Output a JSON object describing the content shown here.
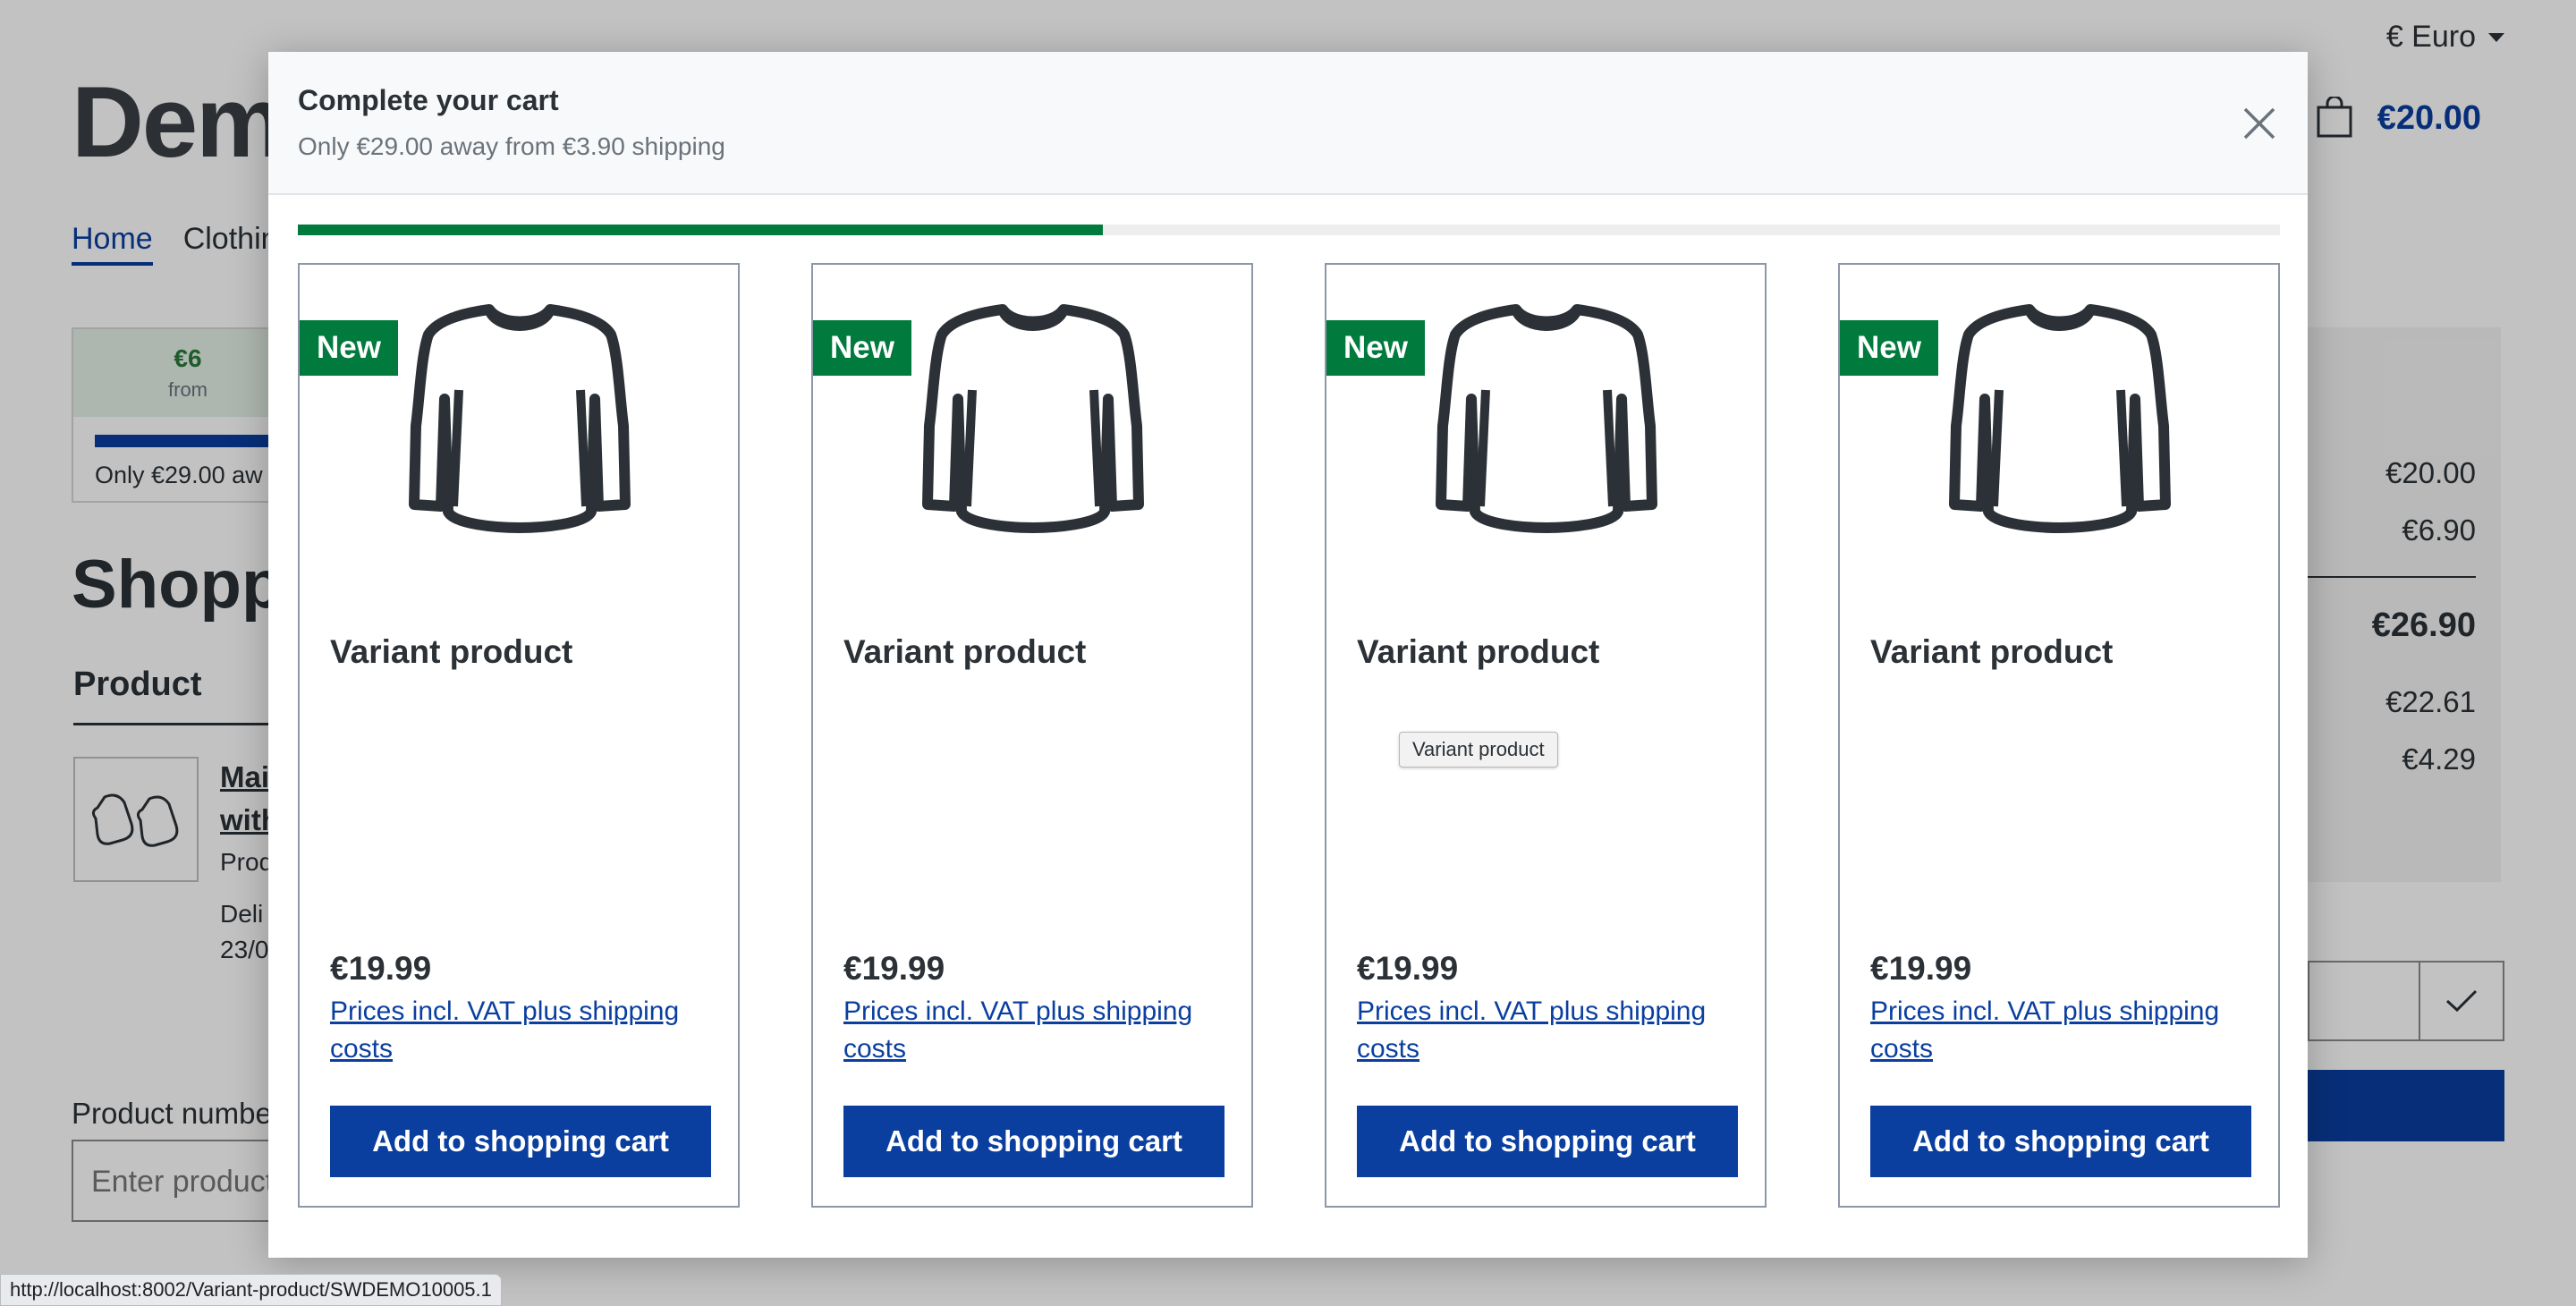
{
  "header": {
    "currency": "€ Euro",
    "logo": "Demo",
    "cart_total": "€20.00"
  },
  "nav": {
    "items": [
      "Home",
      "Clothin"
    ]
  },
  "shipping_box": {
    "amount": "€6",
    "from": "from",
    "progress_text": "Only €29.00 aw"
  },
  "page": {
    "title": "Shopp",
    "product_heading": "Product",
    "product_name_line1": "Mai",
    "product_name_line2": "with",
    "product_meta": "Prod",
    "delivery_line1": "Deli",
    "delivery_line2": "23/0",
    "product_number_label": "Product numbe",
    "product_number_placeholder": "Enter product"
  },
  "summary": {
    "rows": [
      "€20.00",
      "€6.90",
      "€26.90",
      "€22.61",
      "€4.29"
    ]
  },
  "modal": {
    "title": "Complete your cart",
    "subtitle": "Only €29.00 away from €3.90 shipping",
    "progress": 0.406,
    "progress_color": "#007a3d",
    "products": [
      {
        "badge": "New",
        "name": "Variant product",
        "price": "€19.99",
        "vat": "Prices incl. VAT plus shipping costs",
        "button": "Add to shopping cart"
      },
      {
        "badge": "New",
        "name": "Variant product",
        "price": "€19.99",
        "vat": "Prices incl. VAT plus shipping costs",
        "button": "Add to shopping cart"
      },
      {
        "badge": "New",
        "name": "Variant product",
        "price": "€19.99",
        "vat": "Prices incl. VAT plus shipping costs",
        "button": "Add to shopping cart"
      },
      {
        "badge": "New",
        "name": "Variant product",
        "price": "€19.99",
        "vat": "Prices incl. VAT plus shipping costs",
        "button": "Add to shopping cart"
      }
    ]
  },
  "tooltip": "Variant product",
  "status_url": "http://localhost:8002/Variant-product/SWDEMO10005.1"
}
